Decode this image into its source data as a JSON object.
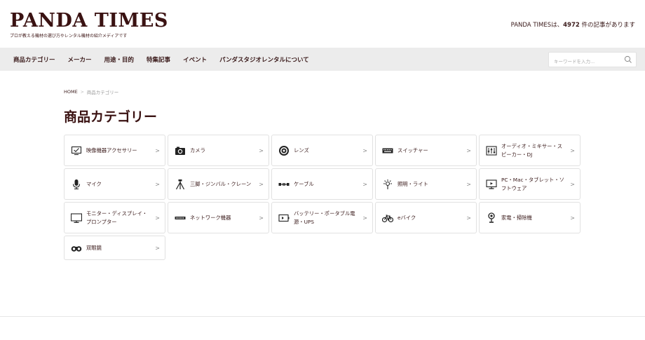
{
  "site": {
    "logo": "PANDA TIMES",
    "tagline": "プロが教える機材の選び方やレンタル機材の紹介メディアです",
    "stats_prefix": "PANDA TIMESは、",
    "stats_count": "4972",
    "stats_suffix": " 件の記事があります"
  },
  "nav": {
    "items": [
      "商品カテゴリー",
      "メーカー",
      "用途・目的",
      "特集記事",
      "イベント",
      "パンダスタジオレンタルについて"
    ],
    "search_placeholder": "キーワードを入力..."
  },
  "breadcrumb": {
    "home": "HOME",
    "separator": ">",
    "current": "商品カテゴリー"
  },
  "page_title": "商品カテゴリー",
  "categories": [
    {
      "label": "映像機器アクセサリー",
      "icon": "checkbox-monitor-icon"
    },
    {
      "label": "カメラ",
      "icon": "camera-icon"
    },
    {
      "label": "レンズ",
      "icon": "lens-icon"
    },
    {
      "label": "スイッチャー",
      "icon": "keyboard-icon"
    },
    {
      "label": "オーディオ・ミキサー・スピーカー・DJ",
      "icon": "mixer-icon"
    },
    {
      "label": "マイク",
      "icon": "microphone-icon"
    },
    {
      "label": "三脚・ジンバル・クレーン",
      "icon": "tripod-icon"
    },
    {
      "label": "ケーブル",
      "icon": "cable-icon"
    },
    {
      "label": "照明・ライト",
      "icon": "light-icon"
    },
    {
      "label": "PC・Mac・タブレット・ソフトウェア",
      "icon": "pc-icon"
    },
    {
      "label": "モニター・ディスプレイ・プロンプター",
      "icon": "monitor-icon"
    },
    {
      "label": "ネットワーク機器",
      "icon": "network-switch-icon"
    },
    {
      "label": "バッテリー・ポータブル電源・UPS",
      "icon": "battery-icon"
    },
    {
      "label": "eバイク",
      "icon": "bicycle-icon"
    },
    {
      "label": "家電・掃除機",
      "icon": "vacuum-icon"
    },
    {
      "label": "双眼鏡",
      "icon": "binoculars-icon"
    }
  ],
  "chevron": ">",
  "colors": {
    "brand": "#3a1212",
    "nav_bg": "#ececec",
    "border": "#e1e1e1"
  }
}
